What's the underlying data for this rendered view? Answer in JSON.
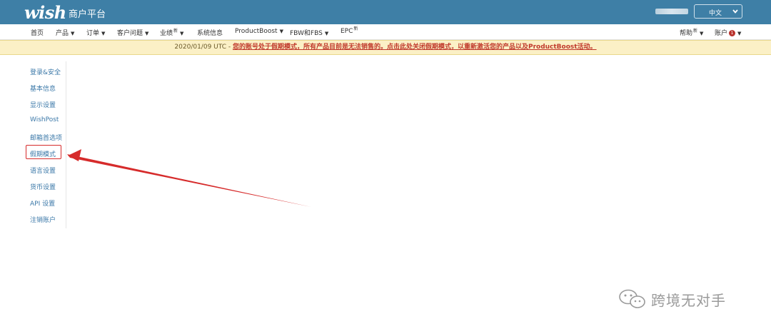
{
  "header": {
    "logo": "wish",
    "platform_title": "商户平台",
    "language": "中文"
  },
  "nav": {
    "home": "首页",
    "products": "产品",
    "orders": "订单",
    "customer_issues": "客户问题",
    "performance": "业绩",
    "performance_badge": "新",
    "system_info": "系统信息",
    "productboost": "ProductBoost",
    "fbw_fbs": "FBW和FBS",
    "epc": "EPC",
    "epc_badge": "新",
    "help": "帮助",
    "help_badge": "新",
    "account": "账户",
    "account_count": "1"
  },
  "banner": {
    "date": "2020/01/09 UTC - ",
    "message": "您的账号处于假期模式，所有产品目前是无法销售的。点击此处关闭假期模式，以重新激活您的产品以及ProductBoost活动。"
  },
  "sidebar": {
    "items": [
      {
        "label": "登录&安全"
      },
      {
        "label": "基本信息"
      },
      {
        "label": "显示设置"
      },
      {
        "label": "WishPost"
      },
      {
        "label": "邮箱首选项"
      },
      {
        "label": "假期模式"
      },
      {
        "label": "语言设置"
      },
      {
        "label": "货币设置"
      },
      {
        "label": "API 设置"
      },
      {
        "label": "注销账户"
      }
    ]
  },
  "watermark": {
    "text": "跨境无对手"
  },
  "colors": {
    "header_bg": "#3e7fa6",
    "link": "#3b78a8",
    "banner_bg": "#fbf0c6",
    "annotation_red": "#d62b2b"
  },
  "icons": [
    "chevron-down-icon",
    "caret-down-icon",
    "wechat-icon"
  ]
}
